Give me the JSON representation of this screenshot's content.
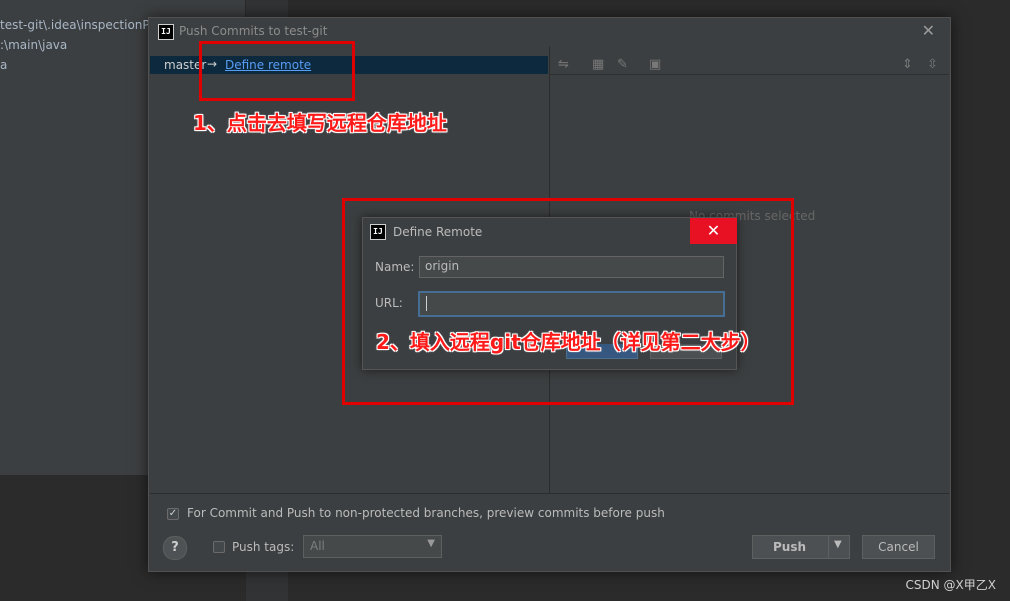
{
  "background": {
    "paths": [
      "test-git\\.idea\\inspectionPr",
      ":\\main\\java",
      "a"
    ]
  },
  "dialog": {
    "title": "Push Commits to test-git",
    "logo_text": "IJ",
    "close_glyph": "✕",
    "branch": {
      "name": "master",
      "arrow": "→",
      "define_remote_link": "Define remote"
    },
    "no_commits_text": "No commits selected",
    "preview_checkbox": {
      "checked": true,
      "label": "For Commit and Push to non-protected branches, preview commits before push"
    },
    "help_glyph": "?",
    "push_tags": {
      "checked": false,
      "label": "Push tags:",
      "value": "All"
    },
    "push_button": "Push",
    "cancel_button": "Cancel"
  },
  "define_remote": {
    "title": "Define Remote",
    "logo_text": "IJ",
    "close_glyph": "✕",
    "name_label": "Name:",
    "name_value": "origin",
    "url_label": "URL:",
    "url_value": ""
  },
  "annotations": {
    "step1": "1、点击去填写远程仓库地址",
    "step2": "2、填入远程git仓库地址（详见第二大步）",
    "color": "#e00000"
  },
  "watermark": "CSDN @X甲乙X"
}
